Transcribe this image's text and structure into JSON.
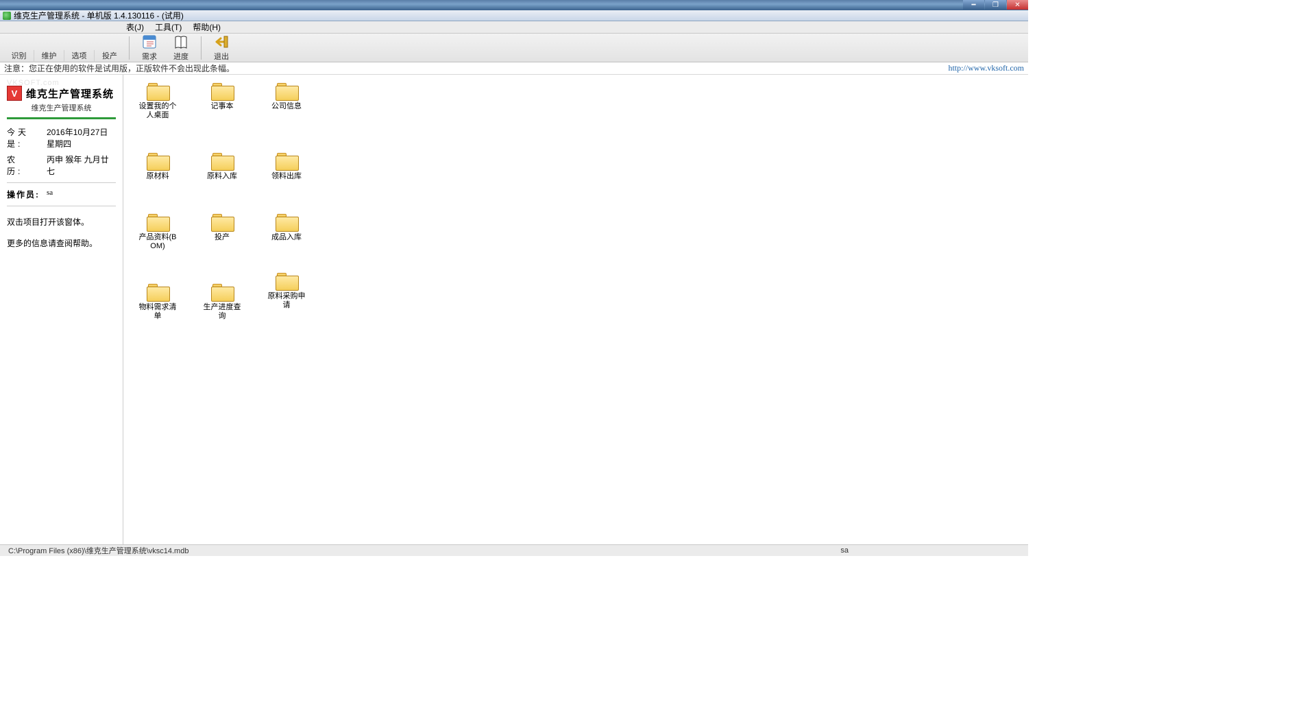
{
  "window": {
    "app_title": "维克生产管理系统 - 单机版 1.4.130116 - (试用)",
    "outer_title_blank": ""
  },
  "menus": {
    "m1": "表(J)",
    "m2": "工具(T)",
    "m3": "帮助(H)"
  },
  "toolbar": {
    "small": [
      "识别",
      "维护",
      "选项",
      "投产"
    ],
    "big1": "需求",
    "big2": "进度",
    "big3": "退出"
  },
  "notice": {
    "text": "注意：您正在使用的软件是试用版，正版软件不会出现此条幅。",
    "url": "http://www.vksoft.com"
  },
  "sidebar": {
    "watermark": "VKSOFT.com",
    "app_title": "维克生产管理系统",
    "subtitle": "维克生产管理系统",
    "today_k": "今天是:",
    "today_v": "2016年10月27日 星期四",
    "lunar_k": "农　历:",
    "lunar_v": "丙申 猴年 九月廿七",
    "oper_k": "操作员:",
    "oper_v": "sa",
    "tip1": "双击项目打开该窗体。",
    "tip2": "更多的信息请查阅帮助。"
  },
  "desktop": {
    "r1": [
      "设置我的个人桌面",
      "记事本",
      "公司信息"
    ],
    "r2": [
      "原材料",
      "原料入库",
      "领料出库"
    ],
    "r3": [
      "产品资料(BOM)",
      "投产",
      "成品入库"
    ],
    "r4": [
      "物料需求清单",
      "生产进度查询",
      "原料采购申请"
    ]
  },
  "statusbar": {
    "path": "C:\\Program Files (x86)\\维克生产管理系统\\vksc14.mdb",
    "user": "sa"
  }
}
